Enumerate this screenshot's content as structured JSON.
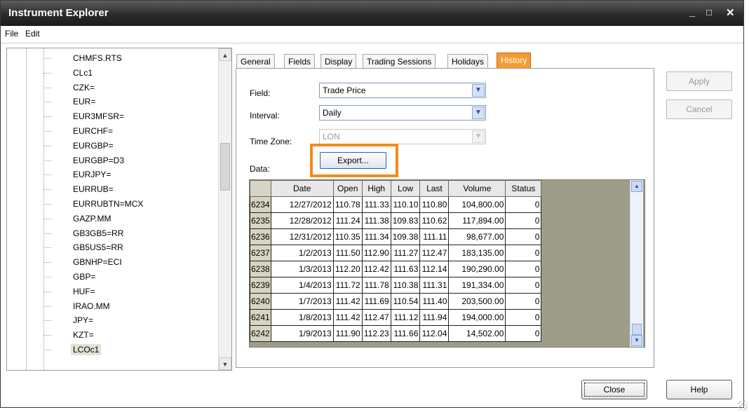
{
  "window": {
    "title": "Instrument Explorer",
    "minimize": "_",
    "maximize": "□",
    "close": "✕"
  },
  "menu": [
    {
      "label": "File"
    },
    {
      "label": "Edit"
    }
  ],
  "tree": {
    "items": [
      {
        "label": "CHMFS.RTS"
      },
      {
        "label": "CLc1"
      },
      {
        "label": "CZK="
      },
      {
        "label": "EUR="
      },
      {
        "label": "EUR3MFSR="
      },
      {
        "label": "EURCHF="
      },
      {
        "label": "EURGBP="
      },
      {
        "label": "EURGBP=D3"
      },
      {
        "label": "EURJPY="
      },
      {
        "label": "EURRUB="
      },
      {
        "label": "EURRUBTN=MCX"
      },
      {
        "label": "GAZP.MM"
      },
      {
        "label": "GB3GB5=RR"
      },
      {
        "label": "GB5US5=RR"
      },
      {
        "label": "GBNHP=ECI"
      },
      {
        "label": "GBP="
      },
      {
        "label": "HUF="
      },
      {
        "label": "IRAO.MM"
      },
      {
        "label": "JPY="
      },
      {
        "label": "KZT="
      },
      {
        "label": "LCOc1",
        "selected": true
      }
    ],
    "scroll_up_icon": "triangle-up",
    "scroll_down_icon": "triangle-down"
  },
  "tabs": [
    {
      "label": "General"
    },
    {
      "label": "Fields"
    },
    {
      "label": "Display"
    },
    {
      "label": "Trading Sessions"
    },
    {
      "label": "Holidays"
    },
    {
      "label": "History",
      "active": true
    }
  ],
  "form": {
    "field_label": "Field:",
    "field_value": "Trade Price",
    "interval_label": "Interval:",
    "interval_value": "Daily",
    "timezone_label": "Time Zone:",
    "timezone_value": "LON",
    "data_label": "Data:",
    "export_label": "Export..."
  },
  "grid": {
    "columns": [
      "",
      "Date",
      "Open",
      "High",
      "Low",
      "Last",
      "Volume",
      "Status"
    ],
    "rows": [
      [
        "6234",
        "12/27/2012",
        "110.78",
        "111.33",
        "110.10",
        "110.80",
        "104,800.00",
        "0"
      ],
      [
        "6235",
        "12/28/2012",
        "111.24",
        "111.38",
        "109.83",
        "110.62",
        "117,894.00",
        "0"
      ],
      [
        "6236",
        "12/31/2012",
        "110.35",
        "111.34",
        "109.38",
        "111.11",
        "98,677.00",
        "0"
      ],
      [
        "6237",
        "1/2/2013",
        "111.50",
        "112.90",
        "111.27",
        "112.47",
        "183,135.00",
        "0"
      ],
      [
        "6238",
        "1/3/2013",
        "112.20",
        "112.42",
        "111.63",
        "112.14",
        "190,290.00",
        "0"
      ],
      [
        "6239",
        "1/4/2013",
        "111.72",
        "111.78",
        "110.38",
        "111.31",
        "191,334.00",
        "0"
      ],
      [
        "6240",
        "1/7/2013",
        "111.42",
        "111.69",
        "110.54",
        "111.40",
        "203,500.00",
        "0"
      ],
      [
        "6241",
        "1/8/2013",
        "111.42",
        "112.47",
        "111.12",
        "111.94",
        "194,000.00",
        "0"
      ],
      [
        "6242",
        "1/9/2013",
        "111.90",
        "112.23",
        "111.66",
        "112.04",
        "14,502.00",
        "0"
      ]
    ]
  },
  "buttons": {
    "apply": "Apply",
    "cancel": "Cancel",
    "close": "Close",
    "help": "Help"
  },
  "colors": {
    "active_tab": "#f59b32",
    "export_highlight": "#f28b1f",
    "titlebar": "#2b2b2b"
  }
}
